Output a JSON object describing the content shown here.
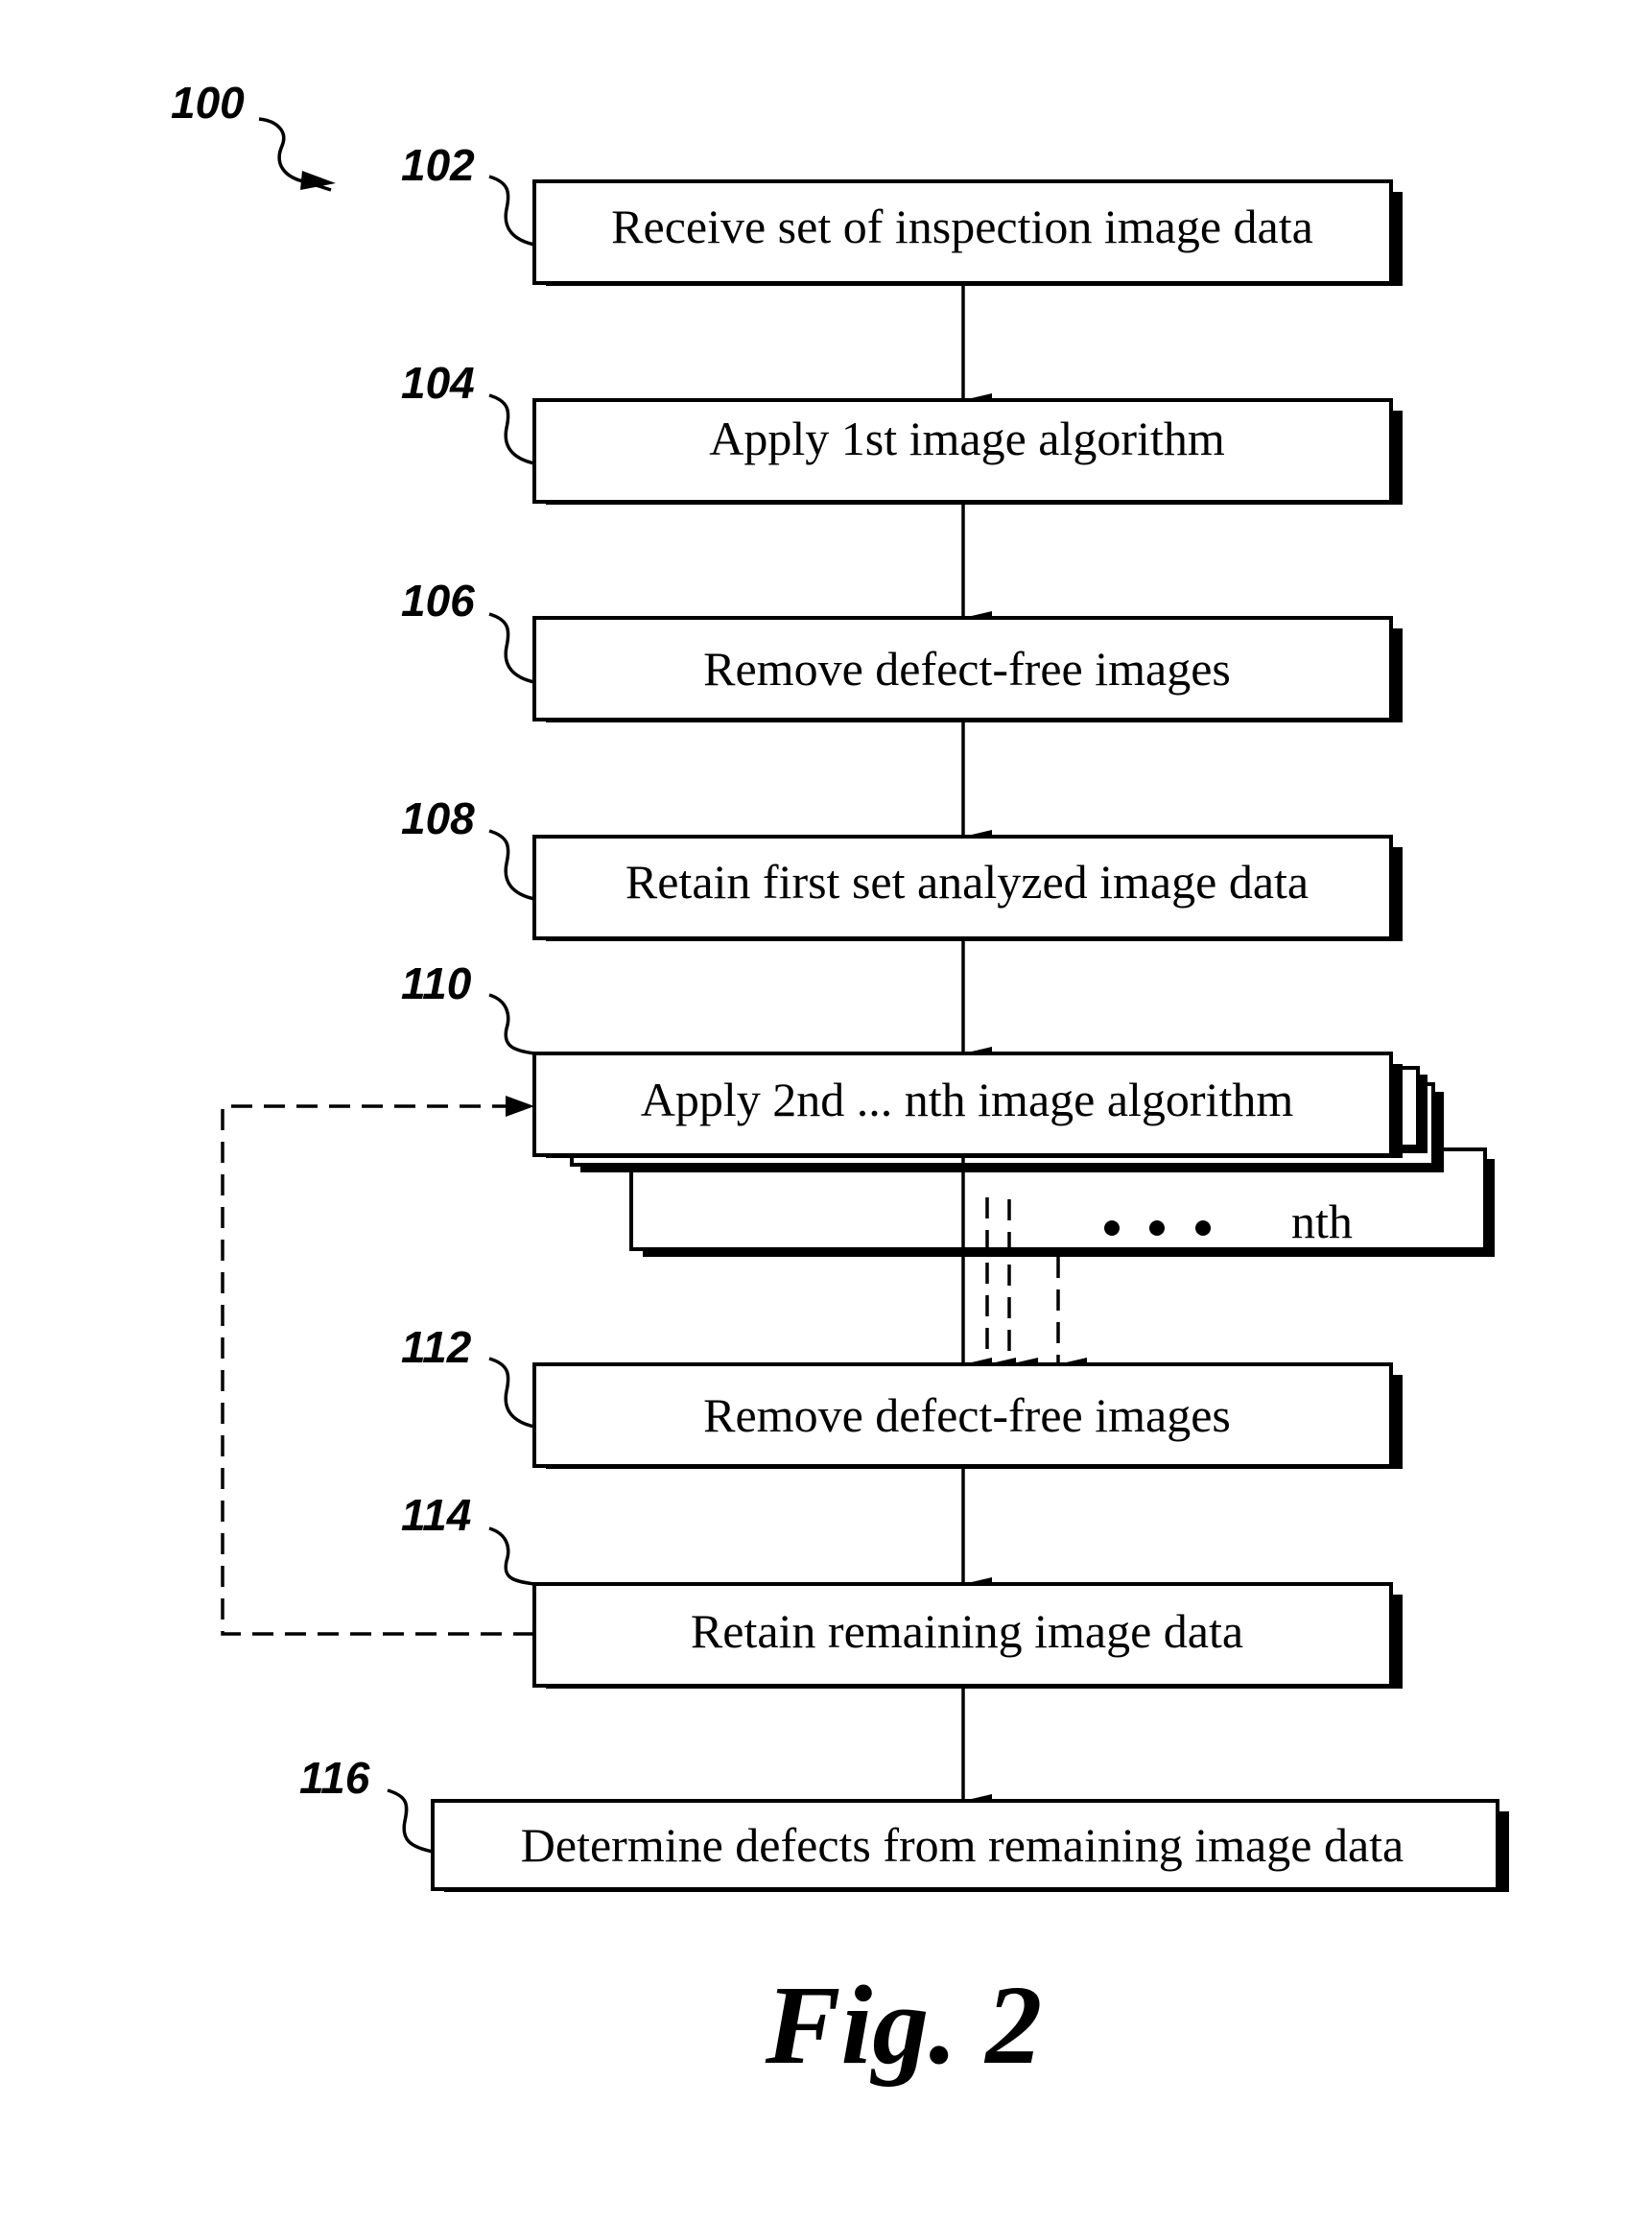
{
  "figure": {
    "caption": "Fig. 2",
    "reference": "100"
  },
  "steps": [
    {
      "ref": "102",
      "label": "Receive set of inspection image data"
    },
    {
      "ref": "104",
      "label": "Apply 1st image algorithm"
    },
    {
      "ref": "106",
      "label": "Remove defect-free images"
    },
    {
      "ref": "108",
      "label": "Retain first set analyzed image data"
    },
    {
      "ref": "110",
      "label": "Apply 2nd ... nth image algorithm"
    },
    {
      "ref": "112",
      "label": "Remove defect-free images"
    },
    {
      "ref": "114",
      "label": "Retain remaining image data"
    },
    {
      "ref": "116",
      "label": "Determine defects from remaining image data"
    }
  ],
  "stack": {
    "nth_label": "nth",
    "ellipsis": "• • •"
  }
}
